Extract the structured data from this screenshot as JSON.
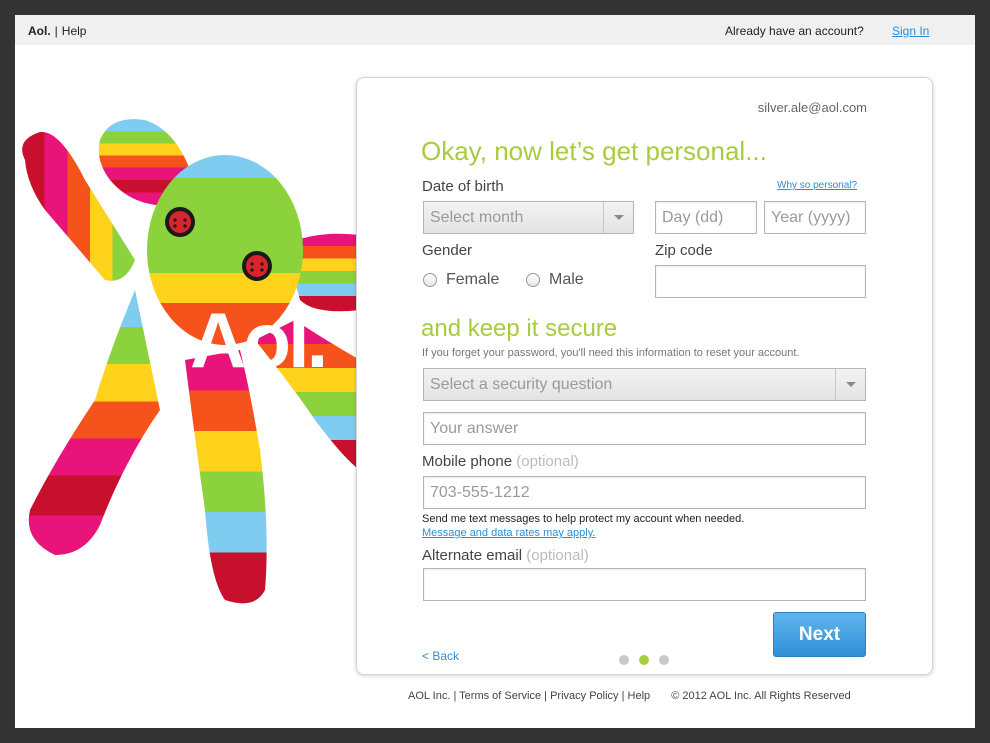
{
  "topbar": {
    "logo": "Aol.",
    "help": "Help",
    "already": "Already have an account?",
    "sign_in": "Sign In"
  },
  "mascot": {
    "logo_text": "Aol."
  },
  "form": {
    "account_email": "silver.ale@aol.com",
    "heading_personal": "Okay, now let’s get personal...",
    "dob_label": "Date of birth",
    "why_link": "Why so personal?",
    "month_placeholder": "Select month",
    "day_placeholder": "Day (dd)",
    "year_placeholder": "Year (yyyy)",
    "gender_label": "Gender",
    "female": "Female",
    "male": "Male",
    "zip_label": "Zip code",
    "zip_value": "",
    "heading_secure": "and keep it secure",
    "secure_hint": "If you forget your password, you'll need this information to reset your account.",
    "security_question_placeholder": "Select a security question",
    "answer_placeholder": "Your answer",
    "mobile_label": "Mobile phone",
    "optional": "(optional)",
    "phone_placeholder": "703-555-1212",
    "sms_text": "Send me text messages to help protect my account when needed.",
    "rates_link": "Message and data rates may apply.",
    "alt_email_label": "Alternate email",
    "alt_email_value": "",
    "next_button": "Next",
    "back_link": "< Back"
  },
  "progress": {
    "total_steps": 3,
    "current_step": 2
  },
  "footer": {
    "company": "AOL Inc.",
    "terms": "Terms of Service",
    "privacy": "Privacy Policy",
    "help": "Help",
    "copyright": "© 2012  AOL Inc. All Rights Reserved"
  },
  "colors": {
    "accent_green": "#a8cc3c",
    "link_blue": "#2a8fd4",
    "button_blue": "#2f8fd6"
  }
}
